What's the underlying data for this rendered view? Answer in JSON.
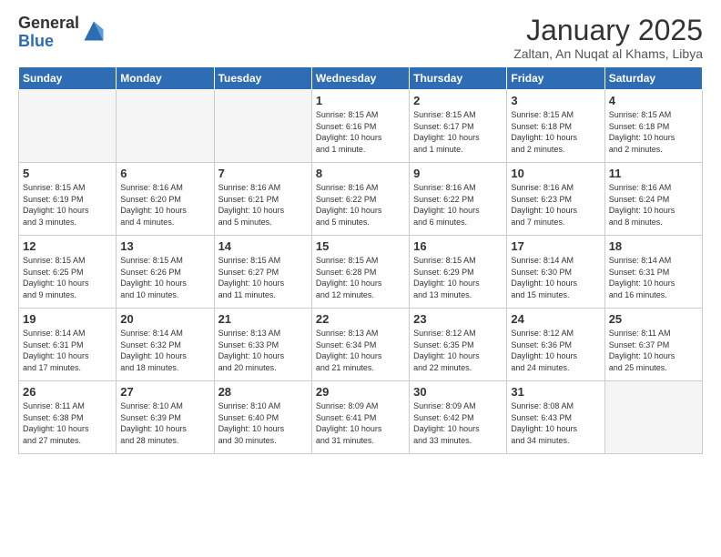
{
  "logo": {
    "general": "General",
    "blue": "Blue"
  },
  "header": {
    "month": "January 2025",
    "location": "Zaltan, An Nuqat al Khams, Libya"
  },
  "weekdays": [
    "Sunday",
    "Monday",
    "Tuesday",
    "Wednesday",
    "Thursday",
    "Friday",
    "Saturday"
  ],
  "weeks": [
    [
      {
        "day": "",
        "info": ""
      },
      {
        "day": "",
        "info": ""
      },
      {
        "day": "",
        "info": ""
      },
      {
        "day": "1",
        "info": "Sunrise: 8:15 AM\nSunset: 6:16 PM\nDaylight: 10 hours\nand 1 minute."
      },
      {
        "day": "2",
        "info": "Sunrise: 8:15 AM\nSunset: 6:17 PM\nDaylight: 10 hours\nand 1 minute."
      },
      {
        "day": "3",
        "info": "Sunrise: 8:15 AM\nSunset: 6:18 PM\nDaylight: 10 hours\nand 2 minutes."
      },
      {
        "day": "4",
        "info": "Sunrise: 8:15 AM\nSunset: 6:18 PM\nDaylight: 10 hours\nand 2 minutes."
      }
    ],
    [
      {
        "day": "5",
        "info": "Sunrise: 8:15 AM\nSunset: 6:19 PM\nDaylight: 10 hours\nand 3 minutes."
      },
      {
        "day": "6",
        "info": "Sunrise: 8:16 AM\nSunset: 6:20 PM\nDaylight: 10 hours\nand 4 minutes."
      },
      {
        "day": "7",
        "info": "Sunrise: 8:16 AM\nSunset: 6:21 PM\nDaylight: 10 hours\nand 5 minutes."
      },
      {
        "day": "8",
        "info": "Sunrise: 8:16 AM\nSunset: 6:22 PM\nDaylight: 10 hours\nand 5 minutes."
      },
      {
        "day": "9",
        "info": "Sunrise: 8:16 AM\nSunset: 6:22 PM\nDaylight: 10 hours\nand 6 minutes."
      },
      {
        "day": "10",
        "info": "Sunrise: 8:16 AM\nSunset: 6:23 PM\nDaylight: 10 hours\nand 7 minutes."
      },
      {
        "day": "11",
        "info": "Sunrise: 8:16 AM\nSunset: 6:24 PM\nDaylight: 10 hours\nand 8 minutes."
      }
    ],
    [
      {
        "day": "12",
        "info": "Sunrise: 8:15 AM\nSunset: 6:25 PM\nDaylight: 10 hours\nand 9 minutes."
      },
      {
        "day": "13",
        "info": "Sunrise: 8:15 AM\nSunset: 6:26 PM\nDaylight: 10 hours\nand 10 minutes."
      },
      {
        "day": "14",
        "info": "Sunrise: 8:15 AM\nSunset: 6:27 PM\nDaylight: 10 hours\nand 11 minutes."
      },
      {
        "day": "15",
        "info": "Sunrise: 8:15 AM\nSunset: 6:28 PM\nDaylight: 10 hours\nand 12 minutes."
      },
      {
        "day": "16",
        "info": "Sunrise: 8:15 AM\nSunset: 6:29 PM\nDaylight: 10 hours\nand 13 minutes."
      },
      {
        "day": "17",
        "info": "Sunrise: 8:14 AM\nSunset: 6:30 PM\nDaylight: 10 hours\nand 15 minutes."
      },
      {
        "day": "18",
        "info": "Sunrise: 8:14 AM\nSunset: 6:31 PM\nDaylight: 10 hours\nand 16 minutes."
      }
    ],
    [
      {
        "day": "19",
        "info": "Sunrise: 8:14 AM\nSunset: 6:31 PM\nDaylight: 10 hours\nand 17 minutes."
      },
      {
        "day": "20",
        "info": "Sunrise: 8:14 AM\nSunset: 6:32 PM\nDaylight: 10 hours\nand 18 minutes."
      },
      {
        "day": "21",
        "info": "Sunrise: 8:13 AM\nSunset: 6:33 PM\nDaylight: 10 hours\nand 20 minutes."
      },
      {
        "day": "22",
        "info": "Sunrise: 8:13 AM\nSunset: 6:34 PM\nDaylight: 10 hours\nand 21 minutes."
      },
      {
        "day": "23",
        "info": "Sunrise: 8:12 AM\nSunset: 6:35 PM\nDaylight: 10 hours\nand 22 minutes."
      },
      {
        "day": "24",
        "info": "Sunrise: 8:12 AM\nSunset: 6:36 PM\nDaylight: 10 hours\nand 24 minutes."
      },
      {
        "day": "25",
        "info": "Sunrise: 8:11 AM\nSunset: 6:37 PM\nDaylight: 10 hours\nand 25 minutes."
      }
    ],
    [
      {
        "day": "26",
        "info": "Sunrise: 8:11 AM\nSunset: 6:38 PM\nDaylight: 10 hours\nand 27 minutes."
      },
      {
        "day": "27",
        "info": "Sunrise: 8:10 AM\nSunset: 6:39 PM\nDaylight: 10 hours\nand 28 minutes."
      },
      {
        "day": "28",
        "info": "Sunrise: 8:10 AM\nSunset: 6:40 PM\nDaylight: 10 hours\nand 30 minutes."
      },
      {
        "day": "29",
        "info": "Sunrise: 8:09 AM\nSunset: 6:41 PM\nDaylight: 10 hours\nand 31 minutes."
      },
      {
        "day": "30",
        "info": "Sunrise: 8:09 AM\nSunset: 6:42 PM\nDaylight: 10 hours\nand 33 minutes."
      },
      {
        "day": "31",
        "info": "Sunrise: 8:08 AM\nSunset: 6:43 PM\nDaylight: 10 hours\nand 34 minutes."
      },
      {
        "day": "",
        "info": ""
      }
    ]
  ]
}
